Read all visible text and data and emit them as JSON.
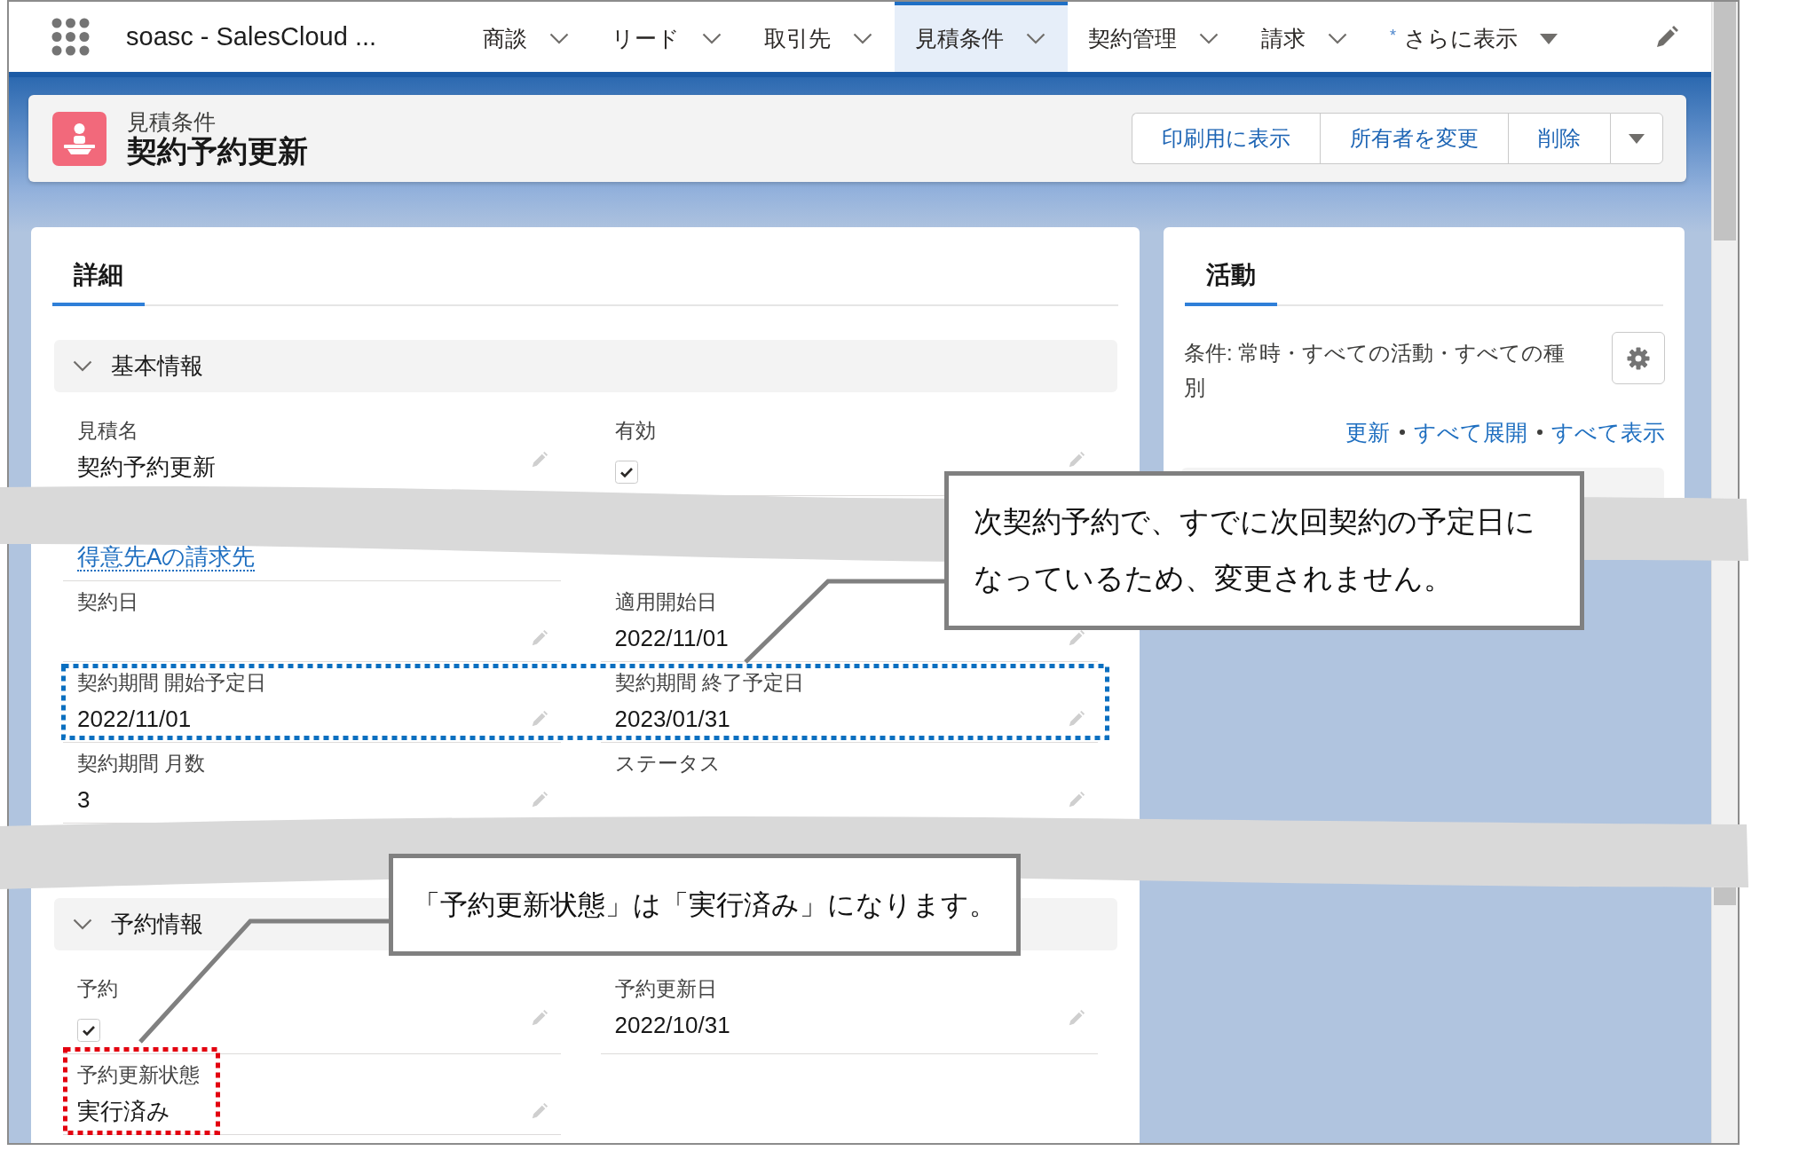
{
  "nav": {
    "app_title": "soasc - SalesCloud ...",
    "tabs": [
      {
        "label": "商談",
        "selected": false
      },
      {
        "label": "リード",
        "selected": false
      },
      {
        "label": "取引先",
        "selected": false
      },
      {
        "label": "見積条件",
        "selected": true
      },
      {
        "label": "契約管理",
        "selected": false
      },
      {
        "label": "請求",
        "selected": false
      }
    ],
    "more": {
      "marker": "*",
      "label": "さらに表示"
    }
  },
  "record_header": {
    "object_type": "見積条件",
    "title": "契約予約更新",
    "actions": [
      "印刷用に表示",
      "所有者を変更",
      "削除"
    ]
  },
  "details": {
    "tab": {
      "label": "詳細",
      "selected": true
    },
    "sections": [
      {
        "title": "基本情報",
        "expanded": true,
        "rows": [
          {
            "highlighted": false,
            "fields": [
              {
                "kind": "text",
                "label": "見積名",
                "value": "契約予約更新",
                "highlighted": false
              },
              {
                "kind": "checkbox",
                "label": "有効",
                "checked": true,
                "highlighted": false
              }
            ]
          },
          {
            "highlighted": false,
            "fields": [
              {
                "kind": "link",
                "value": "得意先Aの請求先",
                "highlighted": false
              }
            ]
          },
          {
            "highlighted": false,
            "fields": [
              {
                "kind": "text",
                "label": "契約日",
                "highlighted": false
              },
              {
                "kind": "text",
                "label": "適用開始日",
                "value": "2022/11/01",
                "highlighted": false
              }
            ]
          },
          {
            "highlighted": true,
            "fields": [
              {
                "kind": "text",
                "label": "契約期間 開始予定日",
                "value": "2022/11/01",
                "highlighted": false
              },
              {
                "kind": "text",
                "label": "契約期間 終了予定日",
                "value": "2023/01/31",
                "highlighted": false
              }
            ]
          },
          {
            "highlighted": false,
            "fields": [
              {
                "kind": "text",
                "label": "契約期間 月数",
                "value": "3",
                "highlighted": false
              },
              {
                "kind": "text",
                "label": "ステータス",
                "highlighted": false
              }
            ]
          }
        ]
      },
      {
        "title": "予約情報",
        "expanded": true,
        "rows": [
          {
            "highlighted": false,
            "fields": [
              {
                "kind": "checkbox",
                "label": "予約",
                "checked": true,
                "highlighted": false
              },
              {
                "kind": "text",
                "label": "予約更新日",
                "value": "2022/10/31",
                "highlighted": false
              }
            ]
          },
          {
            "highlighted": false,
            "fields": [
              {
                "kind": "text",
                "label": "予約更新状態",
                "value": "実行済み",
                "highlighted": true
              }
            ]
          }
        ]
      }
    ]
  },
  "activity": {
    "tab": {
      "label": "活動",
      "selected": true
    },
    "filter": "条件: 常時・すべての活動・すべての種別",
    "links": [
      "更新",
      "すべて展開",
      "すべて表示"
    ]
  },
  "callouts": [
    {
      "text": "次契約予約で、すでに次回契約の予定日になっているため、変更されません。"
    },
    {
      "text": "「予約更新状態」は「実行済み」になります。"
    }
  ]
}
